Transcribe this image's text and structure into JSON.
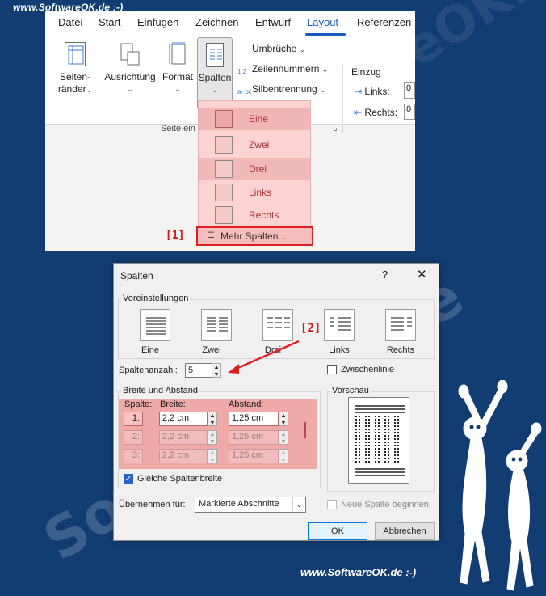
{
  "watermark": {
    "top": "www.SoftwareOK.de :-)",
    "bottom": "www.SoftwareOK.de :-)",
    "diag": "SoftwareOK.de"
  },
  "ribbon": {
    "tabs": [
      "Datei",
      "Start",
      "Einfügen",
      "Zeichnen",
      "Entwurf",
      "Layout",
      "Referenzen"
    ],
    "active_tab": "Layout",
    "buttons": {
      "seitenraender": "Seiten-\nränder",
      "seitenraender_l1": "Seiten-",
      "seitenraender_l2": "ränder",
      "ausrichtung": "Ausrichtung",
      "format": "Format",
      "spalten": "Spalten",
      "umbrueche": "Umbrüche",
      "zeilennummern": "Zeilennummern",
      "silbentrennung": "Silbentrennung"
    },
    "group_label": "Seite ein",
    "indent": {
      "title": "Einzug",
      "links": "Links:",
      "rechts": "Rechts:",
      "links_val": "0",
      "rechts_val": "0"
    }
  },
  "dropdown": {
    "items": [
      "Eine",
      "Zwei",
      "Drei",
      "Links",
      "Rechts"
    ],
    "more": "Mehr Spalten..."
  },
  "markers": {
    "m1": "[1]",
    "m2": "[2]"
  },
  "dialog": {
    "title": "Spalten",
    "help": "?",
    "close": "✕",
    "presets_label": "Voreinstellungen",
    "presets": [
      "Eine",
      "Zwei",
      "Drei",
      "Links",
      "Rechts"
    ],
    "spaltenanzahl_label": "Spaltenanzahl:",
    "spaltenanzahl_value": "5",
    "zwischenlinie": "Zwischenlinie",
    "breite_label": "Breite und Abstand",
    "col_headers": {
      "spalte": "Spalte:",
      "breite": "Breite:",
      "abstand": "Abstand:"
    },
    "rows": [
      {
        "spalte": "1:",
        "breite": "2,2 cm",
        "abstand": "1,25 cm"
      },
      {
        "spalte": "2:",
        "breite": "2,2 cm",
        "abstand": "1,25 cm"
      },
      {
        "spalte": "3:",
        "breite": "2,2 cm",
        "abstand": "1,25 cm"
      }
    ],
    "gleiche": "Gleiche Spaltenbreite",
    "vorschau": "Vorschau",
    "uebernehmen_label": "Übernehmen für:",
    "uebernehmen_value": "Markierte Abschnitte",
    "neue_spalte": "Neue Spalte beginnen",
    "ok": "OK",
    "abbrechen": "Abbrechen"
  }
}
